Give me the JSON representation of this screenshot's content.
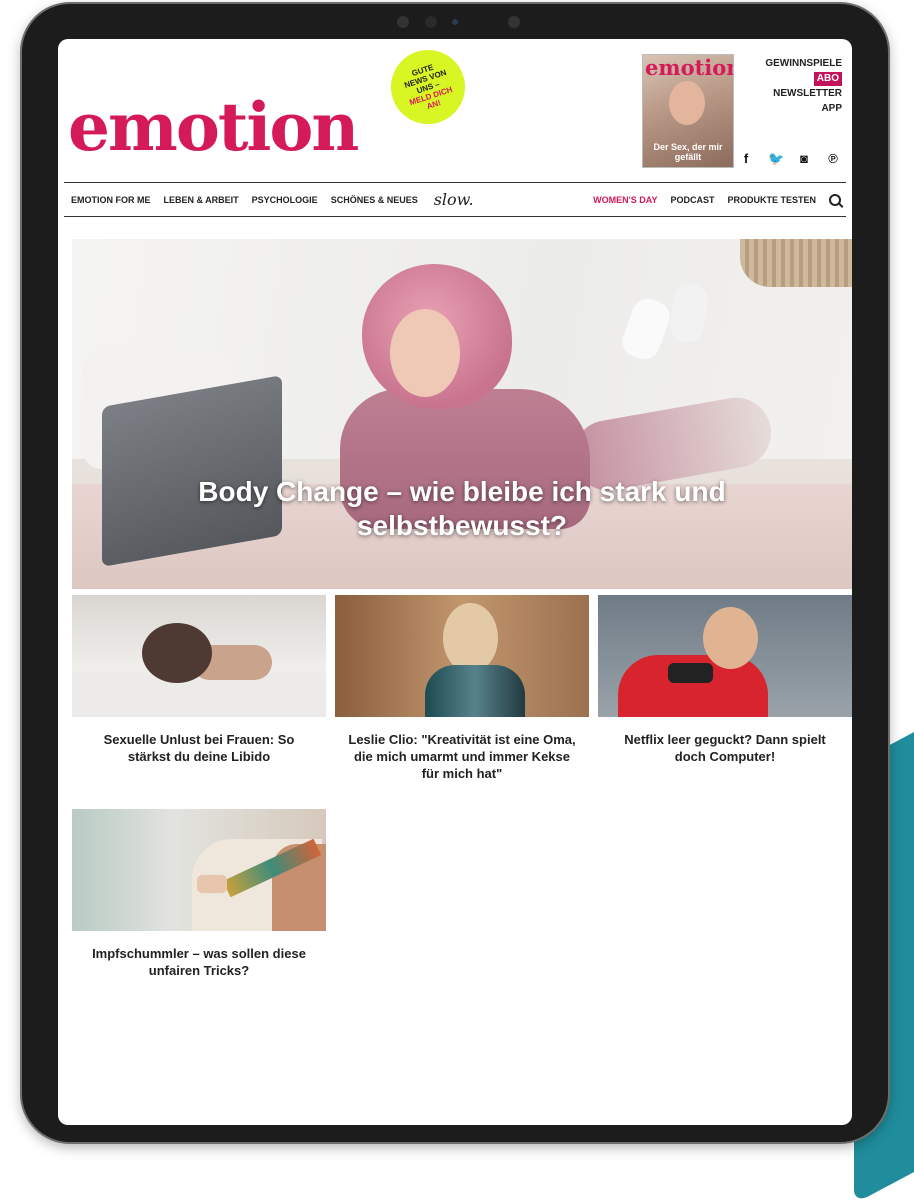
{
  "brand": {
    "logo": "emotion",
    "accent": "#d51a5a"
  },
  "sticker": {
    "line1": "GUTE",
    "line2": "NEWS VON",
    "line3": "UNS –",
    "line4": "MELD DICH",
    "line5": "AN!",
    "color": "#d8f524"
  },
  "magazine": {
    "logo": "emotion",
    "coverline": "Der Sex, der mir gefällt"
  },
  "toplinks": {
    "gewinnspiele": "GEWINNSPIELE",
    "abo": "ABO",
    "newsletter": "NEWSLETTER",
    "app": "APP"
  },
  "social": {
    "facebook": "f",
    "twitter": "🐦",
    "instagram": "◙",
    "pinterest": "℗"
  },
  "nav": {
    "items": [
      "EMOTION FOR ME",
      "LEBEN & ARBEIT",
      "PSYCHOLOGIE",
      "SCHÖNES & NEUES"
    ],
    "slow": "slow.",
    "right": [
      "WOMEN'S DAY",
      "PODCAST",
      "PRODUKTE TESTEN"
    ]
  },
  "hero": {
    "title": "Body Change – wie bleibe ich stark und selbstbewusst?"
  },
  "articles": [
    {
      "title": "Sexuelle Unlust bei Frauen: So stärkst du deine Libido"
    },
    {
      "title": "Leslie Clio: \"Kreativität ist eine Oma, die mich umarmt und immer Kekse für mich hat\""
    },
    {
      "title": "Netflix leer geguckt? Dann spielt doch Computer!"
    },
    {
      "title": "Impfschummler – was sollen diese unfairen Tricks?"
    }
  ]
}
